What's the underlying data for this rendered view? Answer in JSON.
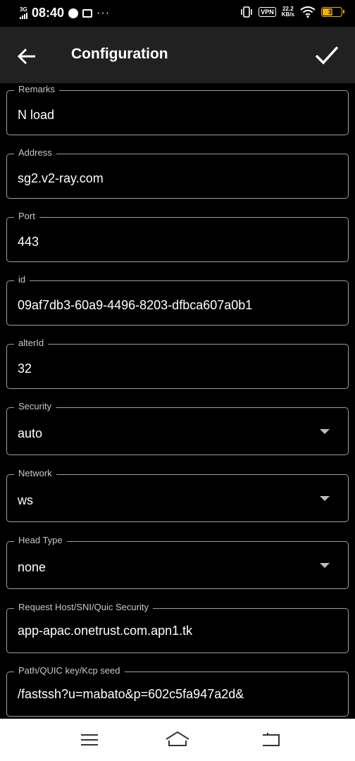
{
  "status_bar": {
    "network": "3G",
    "time": "08:40",
    "more": "···",
    "vpn": "VPN",
    "speed_value": "22.2",
    "speed_unit": "KB/s",
    "battery": "39"
  },
  "toolbar": {
    "title": "Configuration"
  },
  "fields": [
    {
      "label": "Remarks",
      "value": "N load"
    },
    {
      "label": "Address",
      "value": "sg2.v2-ray.com"
    },
    {
      "label": "Port",
      "value": "443"
    },
    {
      "label": "id",
      "value": "09af7db3-60a9-4496-8203-dfbca607a0b1"
    },
    {
      "label": "alterId",
      "value": "32"
    },
    {
      "label": "Security",
      "value": "auto"
    },
    {
      "label": "Network",
      "value": "ws"
    },
    {
      "label": "Head Type",
      "value": "none"
    },
    {
      "label": "Request Host/SNI/Quic Security",
      "value": "app-apac.onetrust.com.apn1.tk"
    },
    {
      "label": "Path/QUIC key/Kcp seed",
      "value": "/fastssh?u=mabato&p=602c5fa947a2d&"
    }
  ],
  "icons": {
    "back": "arrow-left-icon",
    "save": "check-icon",
    "dropdown": "caret-down-icon",
    "nav_menu": "menu-icon",
    "nav_home": "home-icon",
    "nav_back": "back-icon"
  },
  "colors": {
    "background": "#000000",
    "toolbar": "#212121",
    "field_border": "#9e9e9e",
    "nav_bar": "#ffffff",
    "battery": "#f4b400"
  }
}
